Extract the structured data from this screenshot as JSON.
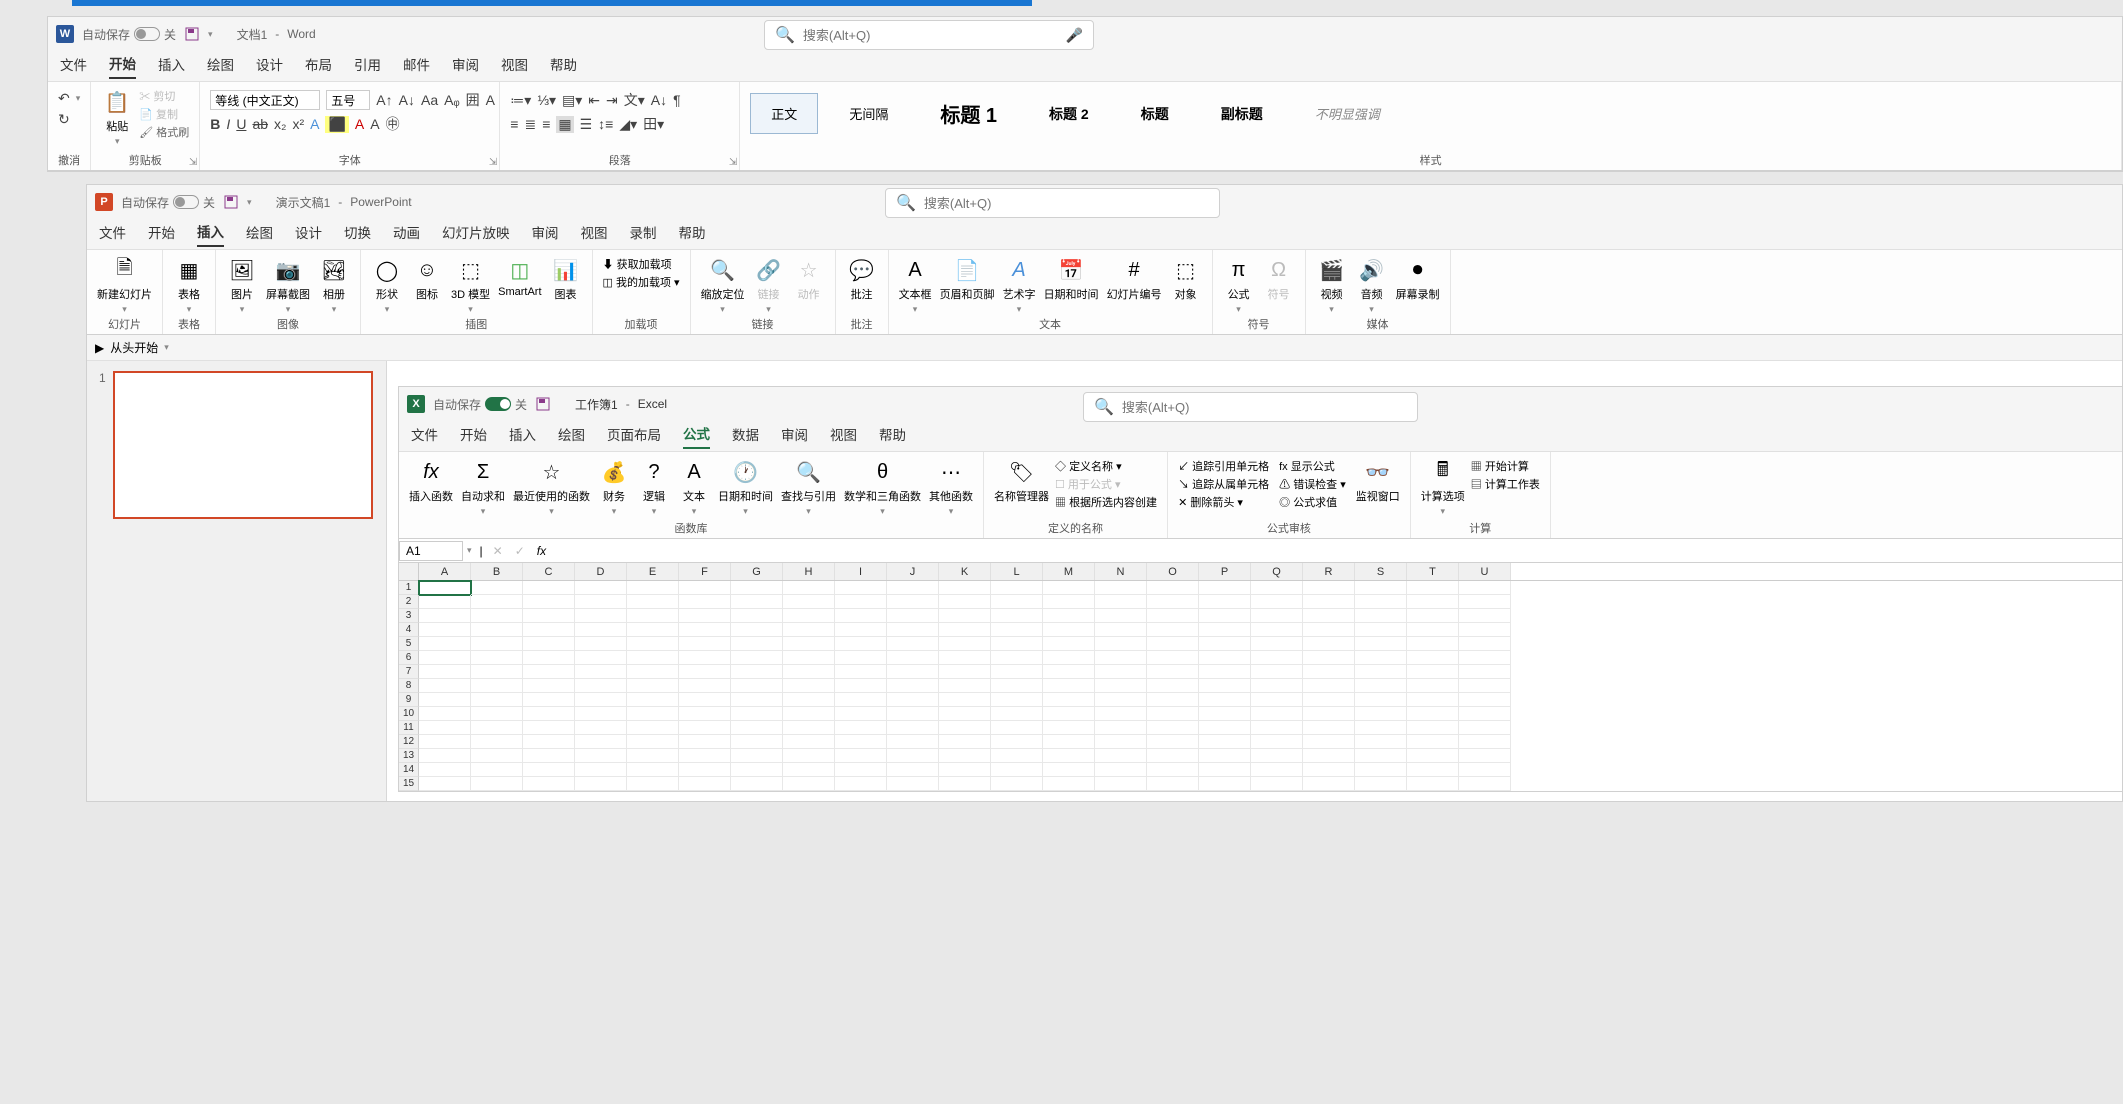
{
  "word": {
    "autosave_label": "自动保存",
    "autosave_state": "关",
    "doc_name": "文档1",
    "app_name": "Word",
    "search_placeholder": "搜索(Alt+Q)",
    "tabs": [
      "文件",
      "开始",
      "插入",
      "绘图",
      "设计",
      "布局",
      "引用",
      "邮件",
      "审阅",
      "视图",
      "帮助"
    ],
    "active_tab": 1,
    "undo_group": "撤消",
    "clipboard": {
      "paste": "粘贴",
      "cut": "剪切",
      "copy": "复制",
      "format_painter": "格式刷",
      "group": "剪贴板"
    },
    "font": {
      "name": "等线 (中文正文)",
      "size": "五号",
      "group": "字体"
    },
    "paragraph": {
      "group": "段落"
    },
    "styles": {
      "group": "样式",
      "items": [
        "正文",
        "无间隔",
        "标题 1",
        "标题 2",
        "标题",
        "副标题",
        "不明显强调"
      ]
    }
  },
  "ppt": {
    "autosave_label": "自动保存",
    "autosave_state": "关",
    "doc_name": "演示文稿1",
    "app_name": "PowerPoint",
    "search_placeholder": "搜索(Alt+Q)",
    "tabs": [
      "文件",
      "开始",
      "插入",
      "绘图",
      "设计",
      "切换",
      "动画",
      "幻灯片放映",
      "审阅",
      "视图",
      "录制",
      "帮助"
    ],
    "active_tab": 2,
    "from_start": "从头开始",
    "slide_number": "1",
    "groups": {
      "slides": {
        "new_slide": "新建幻灯片",
        "label": "幻灯片"
      },
      "tables": {
        "table": "表格",
        "label": "表格"
      },
      "images": {
        "pictures": "图片",
        "screenshot": "屏幕截图",
        "album": "相册",
        "label": "图像"
      },
      "illustrations": {
        "shapes": "形状",
        "icons": "图标",
        "models": "3D 模型",
        "smartart": "SmartArt",
        "chart": "图表",
        "label": "插图"
      },
      "addins": {
        "get": "获取加载项",
        "my": "我的加载项",
        "label": "加载项"
      },
      "links": {
        "zoom": "缩放定位",
        "link": "链接",
        "action": "动作",
        "label": "链接"
      },
      "comments": {
        "comment": "批注",
        "label": "批注"
      },
      "text": {
        "textbox": "文本框",
        "header_footer": "页眉和页脚",
        "wordart": "艺术字",
        "date": "日期和时间",
        "slide_num": "幻灯片编号",
        "object": "对象",
        "label": "文本"
      },
      "symbols": {
        "equation": "公式",
        "symbol": "符号",
        "label": "符号"
      },
      "media": {
        "video": "视频",
        "audio": "音频",
        "screen_rec": "屏幕录制",
        "label": "媒体"
      }
    }
  },
  "excel": {
    "autosave_label": "自动保存",
    "autosave_state": "关",
    "doc_name": "工作簿1",
    "app_name": "Excel",
    "search_placeholder": "搜索(Alt+Q)",
    "tabs": [
      "文件",
      "开始",
      "插入",
      "绘图",
      "页面布局",
      "公式",
      "数据",
      "审阅",
      "视图",
      "帮助"
    ],
    "active_tab": 5,
    "cell_ref": "A1",
    "cols": [
      "A",
      "B",
      "C",
      "D",
      "E",
      "F",
      "G",
      "H",
      "I",
      "J",
      "K",
      "L",
      "M",
      "N",
      "O",
      "P",
      "Q",
      "R",
      "S",
      "T",
      "U"
    ],
    "rows": [
      "1",
      "2",
      "3",
      "4",
      "5",
      "6",
      "7",
      "8",
      "9",
      "10",
      "11",
      "12",
      "13",
      "14",
      "15"
    ],
    "groups": {
      "lib": {
        "insert_fn": "插入函数",
        "autosum": "自动求和",
        "recent": "最近使用的函数",
        "financial": "财务",
        "logical": "逻辑",
        "text": "文本",
        "date": "日期和时间",
        "lookup": "查找与引用",
        "math": "数学和三角函数",
        "more": "其他函数",
        "label": "函数库"
      },
      "names": {
        "mgr": "名称管理器",
        "define": "定义名称",
        "use": "用于公式",
        "create": "根据所选内容创建",
        "label": "定义的名称"
      },
      "audit": {
        "trace_prec": "追踪引用单元格",
        "trace_dep": "追踪从属单元格",
        "remove": "删除箭头",
        "show": "显示公式",
        "error": "错误检查",
        "eval": "公式求值",
        "watch": "监视窗口",
        "label": "公式审核"
      },
      "calc": {
        "options": "计算选项",
        "now": "开始计算",
        "sheet": "计算工作表",
        "label": "计算"
      }
    }
  }
}
